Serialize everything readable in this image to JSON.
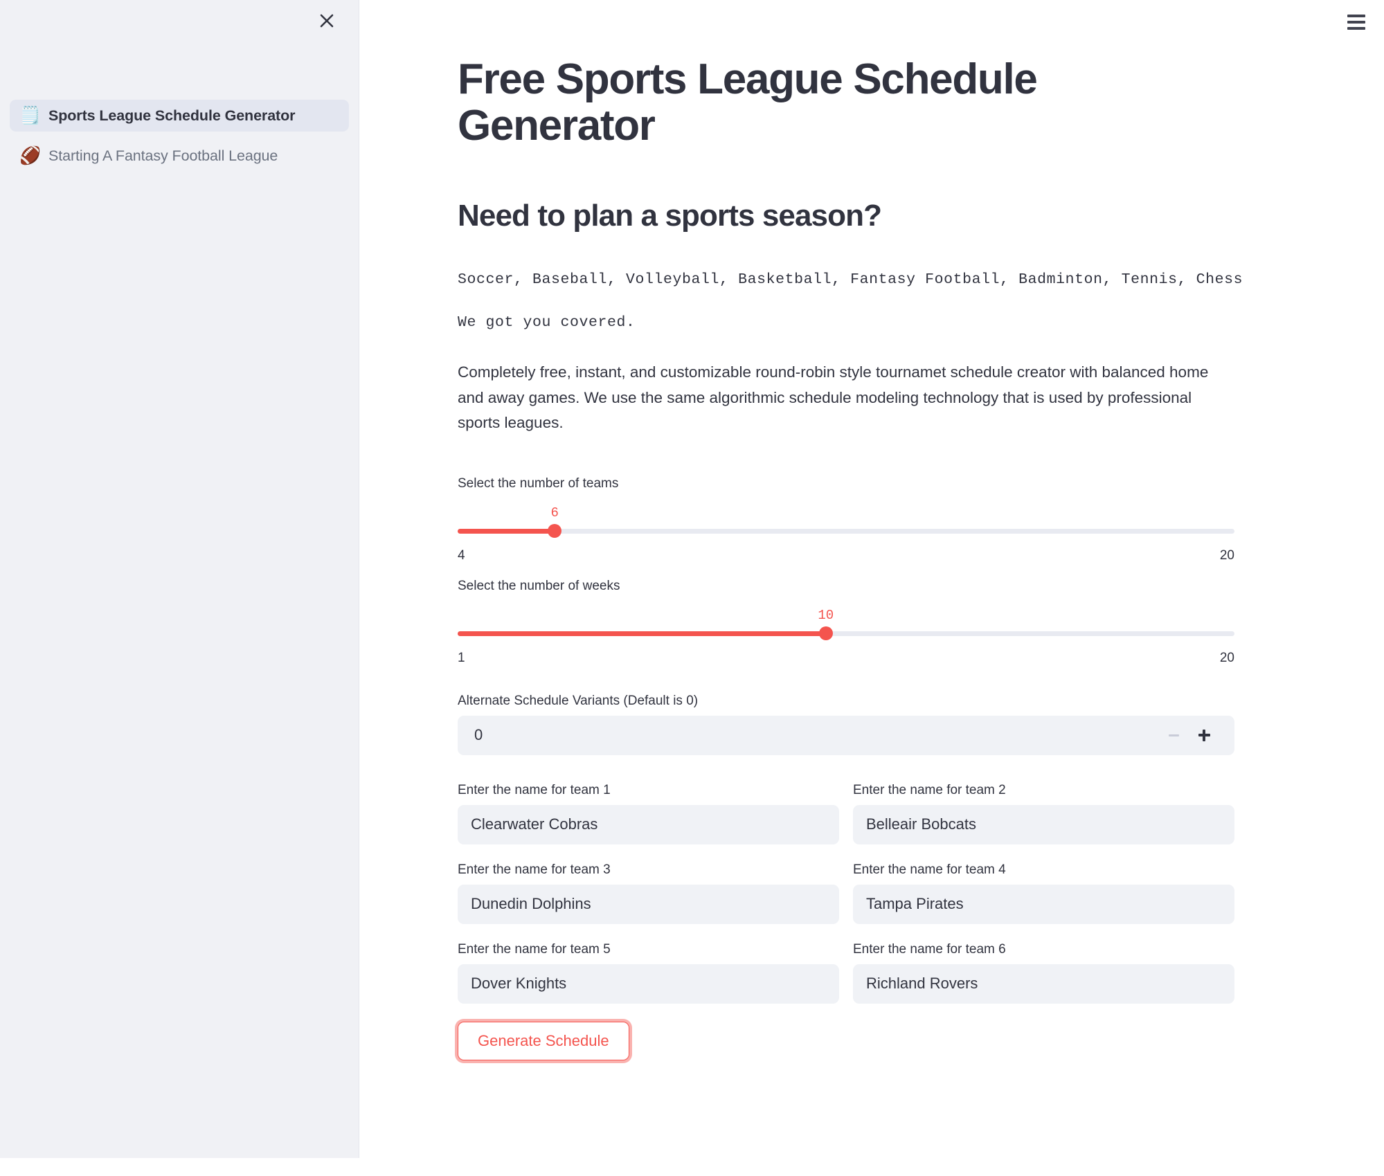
{
  "sidebar": {
    "close_icon": "close-icon",
    "items": [
      {
        "emoji": "🗒️",
        "icon_name": "notepad-icon",
        "label": "Sports League Schedule Generator",
        "selected": true
      },
      {
        "emoji": "🏈",
        "icon_name": "football-icon",
        "label": "Starting A Fantasy Football League",
        "selected": false
      }
    ]
  },
  "header": {
    "menu_icon": "hamburger-menu-icon"
  },
  "main": {
    "title": "Free Sports League Schedule Generator",
    "subtitle": "Need to plan a sports season?",
    "mono_line_1": "Soccer, Baseball, Volleyball, Basketball, Fantasy Football, Badminton, Tennis, Chess",
    "mono_line_2": "We got you covered.",
    "description": "Completely free, instant, and customizable round-robin style tournamet schedule creator with balanced home and away games. We use the same algorithmic schedule modeling technology that is used by professional sports leagues."
  },
  "teams_slider": {
    "label": "Select the number of teams",
    "value": "6",
    "min": "4",
    "max": "20",
    "percent": 12.5
  },
  "weeks_slider": {
    "label": "Select the number of weeks",
    "value": "10",
    "min": "1",
    "max": "20",
    "percent": 47.4
  },
  "variants_stepper": {
    "label": "Alternate Schedule Variants (Default is 0)",
    "value": "0",
    "decrement_label": "minus-icon",
    "increment_label": "plus-icon"
  },
  "team_fields": [
    {
      "label": "Enter the name for team 1",
      "value": "Clearwater Cobras"
    },
    {
      "label": "Enter the name for team 2",
      "value": "Belleair Bobcats"
    },
    {
      "label": "Enter the name for team 3",
      "value": "Dunedin Dolphins"
    },
    {
      "label": "Enter the name for team 4",
      "value": "Tampa Pirates"
    },
    {
      "label": "Enter the name for team 5",
      "value": "Dover Knights"
    },
    {
      "label": "Enter the name for team 6",
      "value": "Richland Rovers"
    }
  ],
  "generate_button": {
    "label": "Generate Schedule"
  },
  "colors": {
    "accent": "#f4544e",
    "text": "#31333f",
    "muted": "#6b7280",
    "sidebar_bg": "#f0f1f5",
    "sidebar_selected": "#e3e6f0",
    "input_bg": "#f0f2f6",
    "track_bg": "#e8eaf1"
  }
}
